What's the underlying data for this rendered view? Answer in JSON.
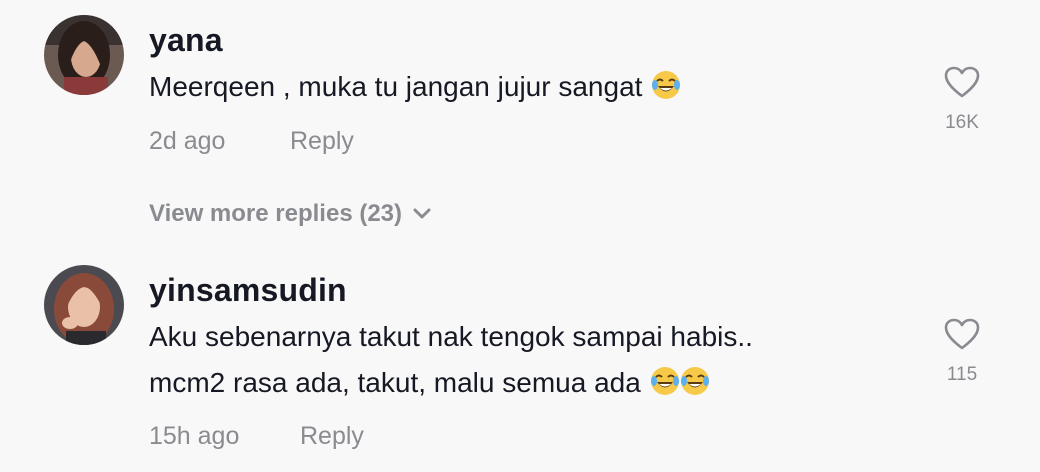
{
  "comments": [
    {
      "username": "yana",
      "text": "Meerqeen , muka tu jangan jujur sangat",
      "emoji_count": 1,
      "emoji": "face-with-tears-of-joy-icon",
      "time": "2d ago",
      "reply_label": "Reply",
      "likes": "16K",
      "view_more": "View more replies (23)"
    },
    {
      "username": "yinsamsudin",
      "text_line1": "Aku sebenarnya takut nak tengok sampai habis..",
      "text_line2": "mcm2 rasa ada, takut, malu semua ada",
      "emoji_count": 2,
      "emoji": "face-with-tears-of-joy-icon",
      "time": "15h ago",
      "reply_label": "Reply",
      "likes": "115"
    }
  ],
  "colors": {
    "background": "#f8f8f8",
    "text_primary": "#161823",
    "text_secondary": "#8a8b91"
  }
}
